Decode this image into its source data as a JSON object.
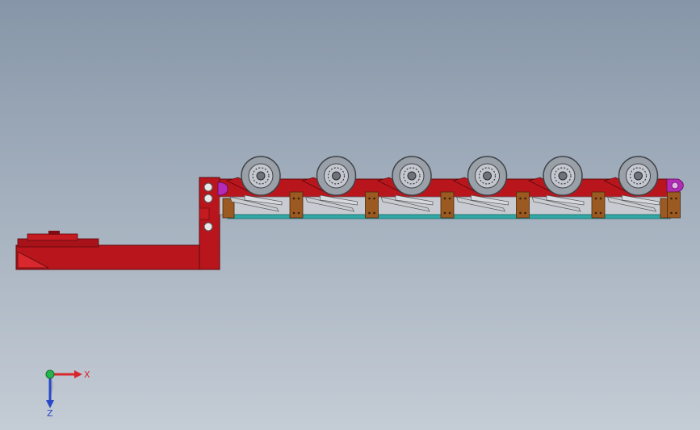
{
  "viewport": {
    "background_top": "#8696a8",
    "background_bottom": "#c4ccd5"
  },
  "model": {
    "frame_color": "#b8161c",
    "frame_dark": "#7c0d12",
    "wheel_color": "#9aa0a8",
    "plate_color": "#9b5a22",
    "rail_color": "#2fa7a4",
    "accent_color": "#b32bb6",
    "axle_count": 6
  },
  "triad": {
    "x_label": "X",
    "z_label": "Z",
    "x_color": "#d9262c",
    "y_color": "#24b64a",
    "z_color": "#2947c8"
  }
}
